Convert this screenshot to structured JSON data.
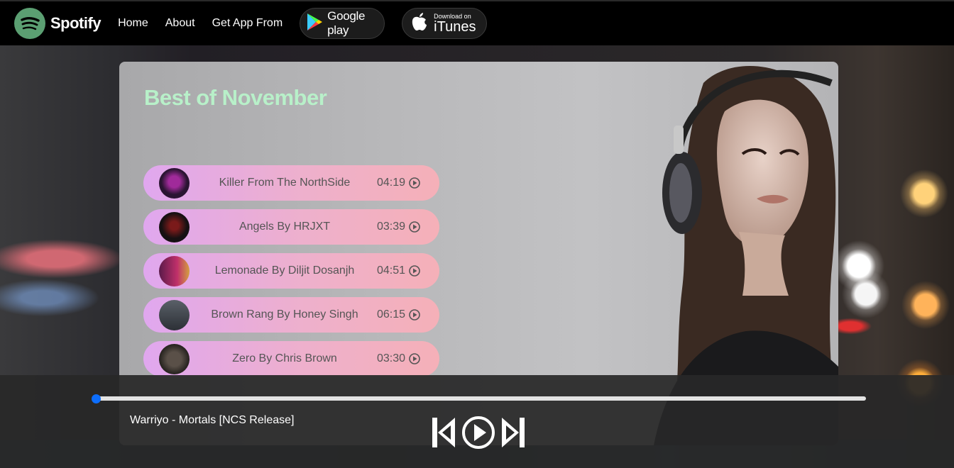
{
  "nav": {
    "brand": "Spotify",
    "links": [
      "Home",
      "About",
      "Get App From"
    ],
    "google_play": "Google play",
    "itunes_small": "Download on",
    "itunes_big": "iTunes"
  },
  "card": {
    "title": "Best of November"
  },
  "songs": [
    {
      "name": "Killer From The NorthSide",
      "duration": "04:19"
    },
    {
      "name": "Angels By HRJXT",
      "duration": "03:39"
    },
    {
      "name": "Lemonade By Diljit Dosanjh",
      "duration": "04:51"
    },
    {
      "name": "Brown Rang By Honey Singh",
      "duration": "06:15"
    },
    {
      "name": "Zero By Chris Brown",
      "duration": "03:30"
    }
  ],
  "player": {
    "now_playing": "Warriyo - Mortals [NCS Release]",
    "progress": 0
  },
  "colors": {
    "brand_green": "#5b9f72",
    "title_green": "#b8f0c9",
    "progress_thumb": "#0d6efd",
    "song_pill_start": "#e0a7ef",
    "song_pill_end": "#f5b0b8"
  },
  "icons": [
    "spotify-logo-icon",
    "google-play-icon",
    "apple-icon",
    "play-circle-icon",
    "previous-icon",
    "play-icon",
    "next-icon"
  ]
}
